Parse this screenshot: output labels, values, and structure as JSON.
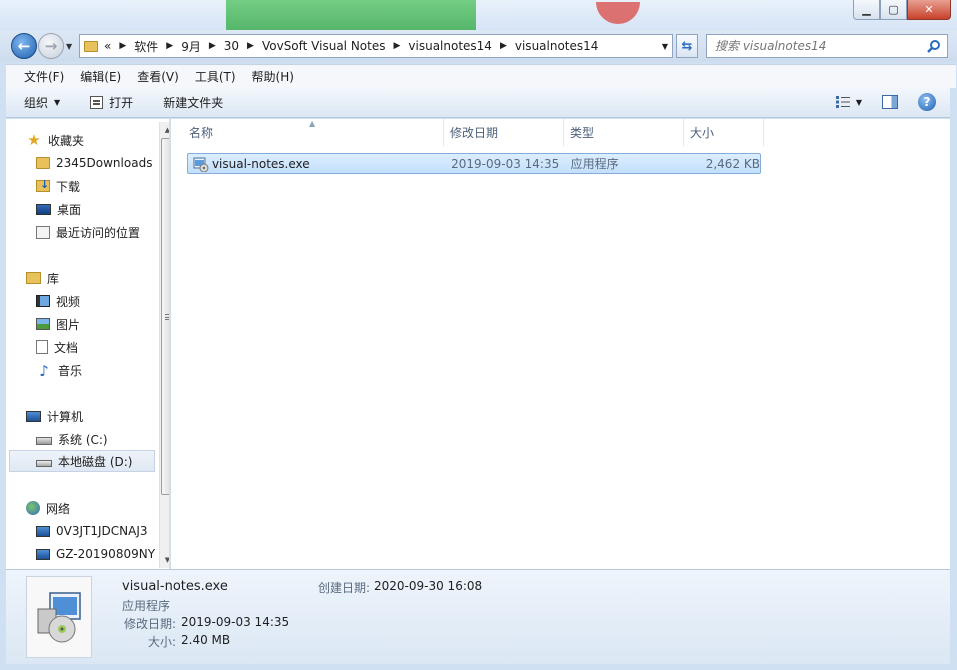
{
  "address": {
    "overflow": "«",
    "crumbs": [
      "软件",
      "9月",
      "30",
      "VovSoft Visual Notes",
      "visualnotes14",
      "visualnotes14"
    ]
  },
  "search": {
    "placeholder": "搜索 visualnotes14"
  },
  "menu": [
    "文件(F)",
    "编辑(E)",
    "查看(V)",
    "工具(T)",
    "帮助(H)"
  ],
  "toolbar": {
    "organize": "组织",
    "open": "打开",
    "new_folder": "新建文件夹"
  },
  "nav": {
    "favorites": "收藏夹",
    "fav_items": [
      "2345Downloads",
      "下载",
      "桌面",
      "最近访问的位置"
    ],
    "libraries": "库",
    "lib_items": [
      "视频",
      "图片",
      "文档",
      "音乐"
    ],
    "computer": "计算机",
    "comp_items": [
      "系统 (C:)",
      "本地磁盘 (D:)"
    ],
    "network": "网络",
    "net_items": [
      "0V3JT1JDCNAJ3",
      "GZ-20190809NY"
    ]
  },
  "columns": [
    "名称",
    "修改日期",
    "类型",
    "大小"
  ],
  "files": [
    {
      "name": "visual-notes.exe",
      "modified": "2019-09-03 14:35",
      "type": "应用程序",
      "size": "2,462 KB"
    }
  ],
  "details": {
    "name": "visual-notes.exe",
    "type": "应用程序",
    "modified_label": "修改日期:",
    "modified": "2019-09-03 14:35",
    "size_label": "大小:",
    "size": "2.40 MB",
    "created_label": "创建日期:",
    "created": "2020-09-30 16:08"
  },
  "colors": {
    "selection": "#cce8ff",
    "accent": "#1f5fae"
  }
}
